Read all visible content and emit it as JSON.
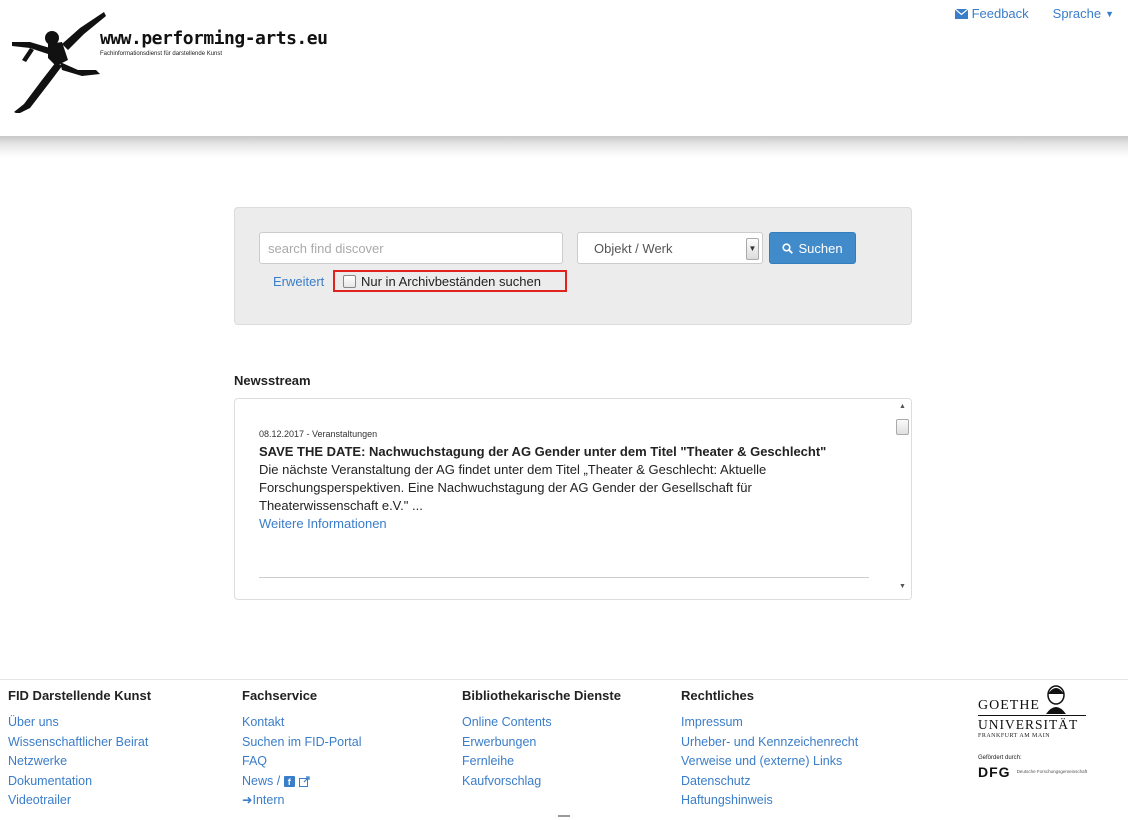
{
  "header": {
    "logo_url": "www.performing-arts.eu",
    "logo_tagline": "Fachinformationsdienst für darstellende Kunst",
    "feedback_label": "Feedback",
    "language_label": "Sprache"
  },
  "search": {
    "placeholder": "search find discover",
    "value": "",
    "select_value": "Objekt / Werk",
    "button_label": "Suchen",
    "advanced_label": "Erweitert",
    "archive_checkbox_label": "Nur in Archivbeständen suchen",
    "archive_checked": false
  },
  "news": {
    "title": "Newsstream",
    "items": [
      {
        "meta": "08.12.2017 - Veranstaltungen",
        "headline": "SAVE THE DATE: Nachwuchstagung der AG Gender unter dem Titel \"Theater & Geschlecht\"",
        "body": "Die nächste Veranstaltung der AG findet unter dem Titel „Theater & Geschlecht: Aktuelle Forschungsperspektiven. Eine Nachwuchstagung der AG Gender der Gesellschaft für Theaterwissenschaft e.V.\" ...",
        "more": "Weitere Informationen"
      }
    ]
  },
  "footer": {
    "columns": [
      {
        "heading": "FID Darstellende Kunst",
        "links": [
          "Über uns",
          "Wissenschaftlicher Beirat",
          "Netzwerke",
          "Dokumentation",
          "Videotrailer"
        ]
      },
      {
        "heading": "Fachservice",
        "links": [
          "Kontakt",
          "Suchen im FID-Portal",
          "FAQ",
          "News /",
          "Intern"
        ]
      },
      {
        "heading": "Bibliothekarische Dienste",
        "links": [
          "Online Contents",
          "Erwerbungen",
          "Fernleihe",
          "Kaufvorschlag"
        ]
      },
      {
        "heading": "Rechtliches",
        "links": [
          "Impressum",
          "Urheber- und Kennzeichenrecht",
          "Verweise und (externe) Links",
          "Datenschutz",
          "Haftungshinweis"
        ]
      }
    ],
    "partner": {
      "goethe_word": "GOETHE",
      "goethe_uni": "UNIVERSITÄT",
      "goethe_city": "FRANKFURT AM MAIN",
      "funded_by": "Gefördert durch:",
      "dfg_logo": "DFG",
      "dfg_text": "Deutsche Forschungsgemeinschaft"
    }
  },
  "colors": {
    "link": "#3a7dc9",
    "button": "#428bca",
    "highlight_border": "#e1231f",
    "panel_bg": "#ececec"
  },
  "icons": {
    "feedback": "envelope-icon",
    "language": "caret-down-icon",
    "search_button": "magnifier-icon",
    "news_social": [
      "facebook-icon",
      "external-link-icon"
    ],
    "intern": "sign-in-icon"
  }
}
